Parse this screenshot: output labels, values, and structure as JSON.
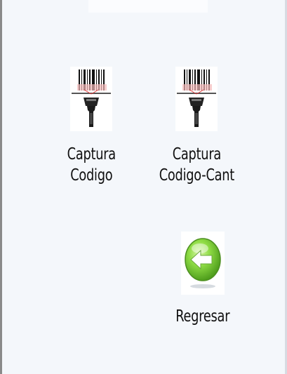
{
  "menu": {
    "items": [
      {
        "label_line1": "Captura",
        "label_line2": "Codigo",
        "icon": "barcode-scanner-icon"
      },
      {
        "label_line1": "Captura",
        "label_line2": "Codigo-Cant",
        "icon": "barcode-scanner-icon"
      },
      {
        "label": "Regresar",
        "icon": "back-arrow-icon"
      }
    ]
  },
  "colors": {
    "background": "#f4f7fb",
    "back_button_green": "#7ed43a",
    "scan_line_red": "#e23a3a"
  }
}
